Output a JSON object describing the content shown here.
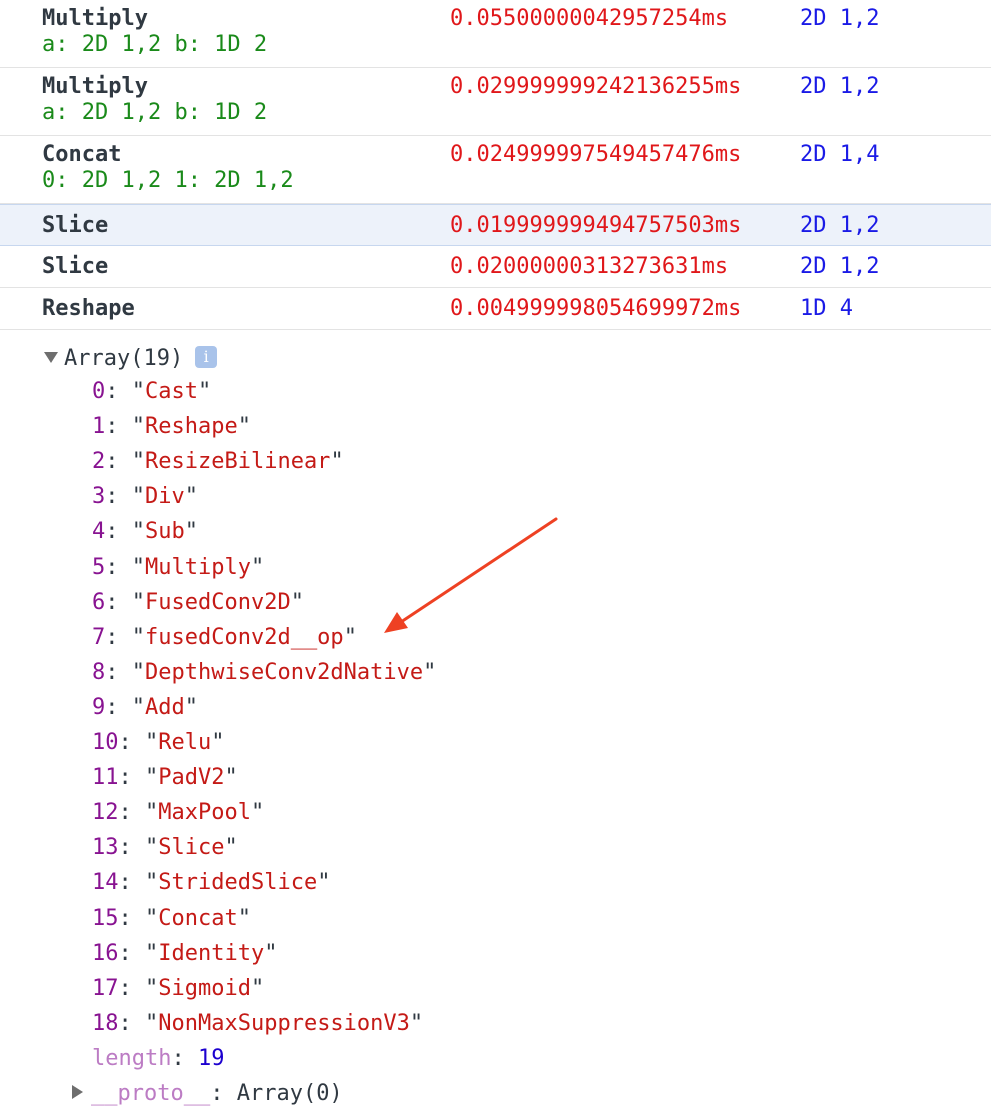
{
  "profile_rows": [
    {
      "name": "Multiply",
      "inputs": "a: 2D 1,2 b: 1D 2",
      "time": "0.05500000042957254ms",
      "shape": "2D 1,2"
    },
    {
      "name": "Multiply",
      "inputs": "a: 2D 1,2 b: 1D 2",
      "time": "0.029999999242136255ms",
      "shape": "2D 1,2"
    },
    {
      "name": "Concat",
      "inputs": "0: 2D 1,2 1: 2D 1,2",
      "time": "0.024999997549457476ms",
      "shape": "2D 1,4"
    },
    {
      "name": "Slice",
      "inputs": "",
      "time": "0.019999999494757503ms",
      "shape": "2D 1,2"
    },
    {
      "name": "Slice",
      "inputs": "",
      "time": "0.02000000313273631ms",
      "shape": "2D 1,2"
    },
    {
      "name": "Reshape",
      "inputs": "",
      "time": "0.004999998054699972ms",
      "shape": "1D 4"
    }
  ],
  "array": {
    "header": "Array(19)",
    "info_badge": "i",
    "items": [
      {
        "index": "0",
        "value": "Cast"
      },
      {
        "index": "1",
        "value": "Reshape"
      },
      {
        "index": "2",
        "value": "ResizeBilinear"
      },
      {
        "index": "3",
        "value": "Div"
      },
      {
        "index": "4",
        "value": "Sub"
      },
      {
        "index": "5",
        "value": "Multiply"
      },
      {
        "index": "6",
        "value": "FusedConv2D"
      },
      {
        "index": "7",
        "value": "fusedConv2d__op"
      },
      {
        "index": "8",
        "value": "DepthwiseConv2dNative"
      },
      {
        "index": "9",
        "value": "Add"
      },
      {
        "index": "10",
        "value": "Relu"
      },
      {
        "index": "11",
        "value": "PadV2"
      },
      {
        "index": "12",
        "value": "MaxPool"
      },
      {
        "index": "13",
        "value": "Slice"
      },
      {
        "index": "14",
        "value": "StridedSlice"
      },
      {
        "index": "15",
        "value": "Concat"
      },
      {
        "index": "16",
        "value": "Identity"
      },
      {
        "index": "17",
        "value": "Sigmoid"
      },
      {
        "index": "18",
        "value": "NonMaxSuppressionV3"
      }
    ],
    "length_key": "length",
    "length_value": "19",
    "proto_key": "__proto__",
    "proto_value": "Array(0)"
  },
  "annotation": {
    "arrow_color": "#ee4123",
    "highlighted_index": "7"
  }
}
